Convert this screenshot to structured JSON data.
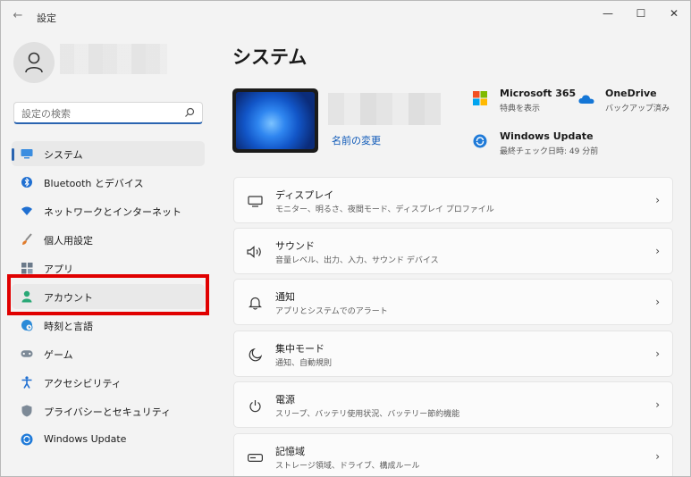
{
  "window": {
    "title": "設定",
    "back_glyph": "←",
    "minimize": "—",
    "maximize": "☐",
    "close": "✕"
  },
  "search": {
    "placeholder": "設定の検索"
  },
  "nav": [
    {
      "label": "システム",
      "icon": "monitor-icon",
      "active": true
    },
    {
      "label": "Bluetooth とデバイス",
      "icon": "bluetooth-icon"
    },
    {
      "label": "ネットワークとインターネット",
      "icon": "wifi-icon"
    },
    {
      "label": "個人用設定",
      "icon": "brush-icon"
    },
    {
      "label": "アプリ",
      "icon": "apps-icon"
    },
    {
      "label": "アカウント",
      "icon": "account-icon",
      "highlighted": true
    },
    {
      "label": "時刻と言語",
      "icon": "globe-clock-icon"
    },
    {
      "label": "ゲーム",
      "icon": "gamepad-icon"
    },
    {
      "label": "アクセシビリティ",
      "icon": "accessibility-icon"
    },
    {
      "label": "プライバシーとセキュリティ",
      "icon": "shield-icon"
    },
    {
      "label": "Windows Update",
      "icon": "update-icon"
    }
  ],
  "main": {
    "title": "システム",
    "rename": "名前の変更",
    "quick": [
      {
        "title": "Microsoft 365",
        "sub": "特典を表示",
        "icon": "microsoft-logo-icon"
      },
      {
        "title": "OneDrive",
        "sub": "バックアップ済み",
        "icon": "cloud-icon"
      },
      {
        "title": "Windows Update",
        "sub": "最終チェック日時: 49 分前",
        "icon": "update-icon"
      }
    ],
    "cards": [
      {
        "title": "ディスプレイ",
        "sub": "モニター、明るさ、夜間モード、ディスプレイ プロファイル",
        "icon": "display-icon"
      },
      {
        "title": "サウンド",
        "sub": "音量レベル、出力、入力、サウンド デバイス",
        "icon": "speaker-icon"
      },
      {
        "title": "通知",
        "sub": "アプリとシステムでのアラート",
        "icon": "bell-icon"
      },
      {
        "title": "集中モード",
        "sub": "通知、自動規則",
        "icon": "moon-icon"
      },
      {
        "title": "電源",
        "sub": "スリープ、バッテリ使用状況、バッテリー節約機能",
        "icon": "power-icon"
      },
      {
        "title": "記憶域",
        "sub": "ストレージ領域、ドライブ、構成ルール",
        "icon": "drive-icon"
      }
    ],
    "chevron": "›"
  },
  "colors": {
    "accent": "#2a64b0",
    "highlight": "#e00000"
  }
}
